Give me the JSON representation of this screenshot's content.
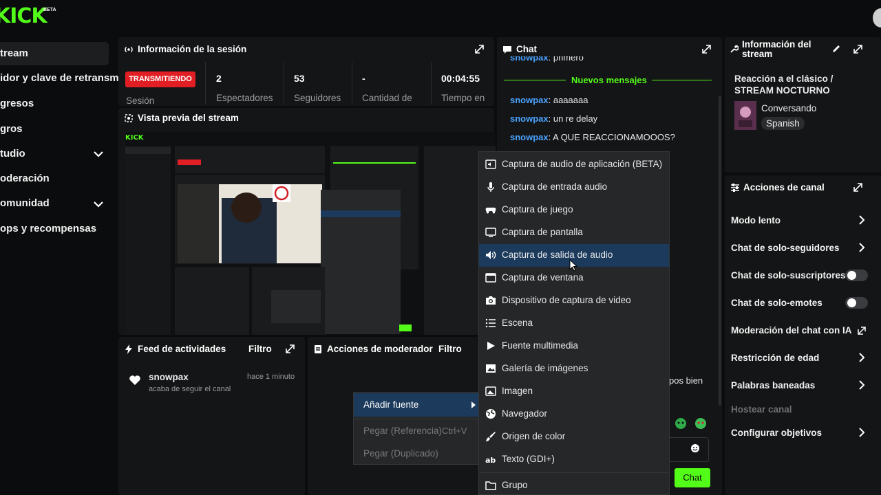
{
  "brand": {
    "logo": "KICK",
    "beta": "BETA"
  },
  "sidebar": {
    "items": [
      {
        "label": "tream",
        "active": true,
        "chevron": false
      },
      {
        "label": "idor y clave de retransm",
        "active": false,
        "chevron": false
      },
      {
        "label": "gresos",
        "active": false,
        "chevron": false
      },
      {
        "label": "gros",
        "active": false,
        "chevron": false
      },
      {
        "label": "tudio",
        "active": false,
        "chevron": true
      },
      {
        "label": "oderación",
        "active": false,
        "chevron": false
      },
      {
        "label": "omunidad",
        "active": false,
        "chevron": true
      },
      {
        "label": "ops y recompensas",
        "active": false,
        "chevron": false
      }
    ]
  },
  "session": {
    "title": "Información de la sesión",
    "status_badge": "TRANSMITIENDO",
    "status_label": "Sesión",
    "stats": [
      {
        "value": "2",
        "label": "Espectadores"
      },
      {
        "value": "53",
        "label": "Seguidores"
      },
      {
        "value": "-",
        "label": "Cantidad de"
      },
      {
        "value": "00:04:55",
        "label": "Tiempo en"
      }
    ]
  },
  "preview": {
    "title": "Vista previa del stream"
  },
  "activity": {
    "title": "Feed de actividades",
    "filter": "Filtro",
    "items": [
      {
        "user": "snowpax",
        "text": "acaba de seguir el canal",
        "time": "hace 1 minuto"
      }
    ]
  },
  "mod_actions": {
    "title": "Acciones de moderador",
    "filter": "Filtro"
  },
  "chat": {
    "title": "Chat",
    "partial_top": {
      "user": "snowpax",
      "text": ": primero"
    },
    "new_messages": "Nuevos mensajes",
    "messages": [
      {
        "user": "snowpax",
        "text": ": aaaaaaa"
      },
      {
        "user": "snowpax",
        "text": ": un re delay"
      },
      {
        "user": "snowpax",
        "text": ": A QUE REACCIONAMOOOS?"
      }
    ],
    "partial_right": "pos bien",
    "send_label": "Chat"
  },
  "stream_info": {
    "title": "Información del stream",
    "stream_title": "Reacción a el clásico / STREAM NOCTURNO",
    "category": "Conversando",
    "language": "Spanish"
  },
  "channel_actions": {
    "title": "Acciones de canal",
    "items": [
      {
        "label": "Modo lento",
        "control": "chevron"
      },
      {
        "label": "Chat de solo-seguidores",
        "control": "chevron"
      },
      {
        "label": "Chat de solo-suscriptores",
        "control": "toggle",
        "on": false
      },
      {
        "label": "Chat de solo-emotes",
        "control": "toggle",
        "on": false
      },
      {
        "label": "Moderación del chat con IA",
        "control": "external"
      },
      {
        "label": "Restricción de edad",
        "control": "chevron"
      },
      {
        "label": "Palabras baneadas",
        "control": "chevron"
      },
      {
        "label": "Hostear canal",
        "control": "none",
        "disabled": true
      },
      {
        "label": "Configurar objetivos",
        "control": "chevron"
      }
    ]
  },
  "context_menu": {
    "items": [
      {
        "label": "Añadir fuente",
        "arrow": true,
        "highlighted": true
      },
      {
        "label": "Pegar (Referencia)",
        "shortcut": "Ctrl+V",
        "disabled": true
      },
      {
        "label": "Pegar (Duplicado)",
        "disabled": true
      }
    ]
  },
  "source_menu": {
    "items": [
      {
        "label": "Captura de audio de aplicación (BETA)",
        "icon": "app-audio-icon"
      },
      {
        "label": "Captura de entrada audio",
        "icon": "microphone-icon"
      },
      {
        "label": "Captura de juego",
        "icon": "gamepad-icon"
      },
      {
        "label": "Captura de pantalla",
        "icon": "monitor-icon"
      },
      {
        "label": "Captura de salida de audio",
        "icon": "speaker-icon",
        "highlighted": true
      },
      {
        "label": "Captura de ventana",
        "icon": "window-icon"
      },
      {
        "label": "Dispositivo de captura de video",
        "icon": "camera-icon"
      },
      {
        "label": "Escena",
        "icon": "list-icon"
      },
      {
        "label": "Fuente multimedia",
        "icon": "play-icon"
      },
      {
        "label": "Galería de imágenes",
        "icon": "gallery-icon"
      },
      {
        "label": "Imagen",
        "icon": "image-icon"
      },
      {
        "label": "Navegador",
        "icon": "globe-icon"
      },
      {
        "label": "Origen de color",
        "icon": "brush-icon"
      },
      {
        "label": "Texto (GDI+)",
        "icon": "text-icon"
      },
      {
        "label": "Grupo",
        "icon": "folder-icon"
      }
    ]
  },
  "colors": {
    "accent": "#53fc18",
    "live": "#e01e24",
    "username": "#4aa3ff",
    "highlight": "#1b3a5c"
  }
}
